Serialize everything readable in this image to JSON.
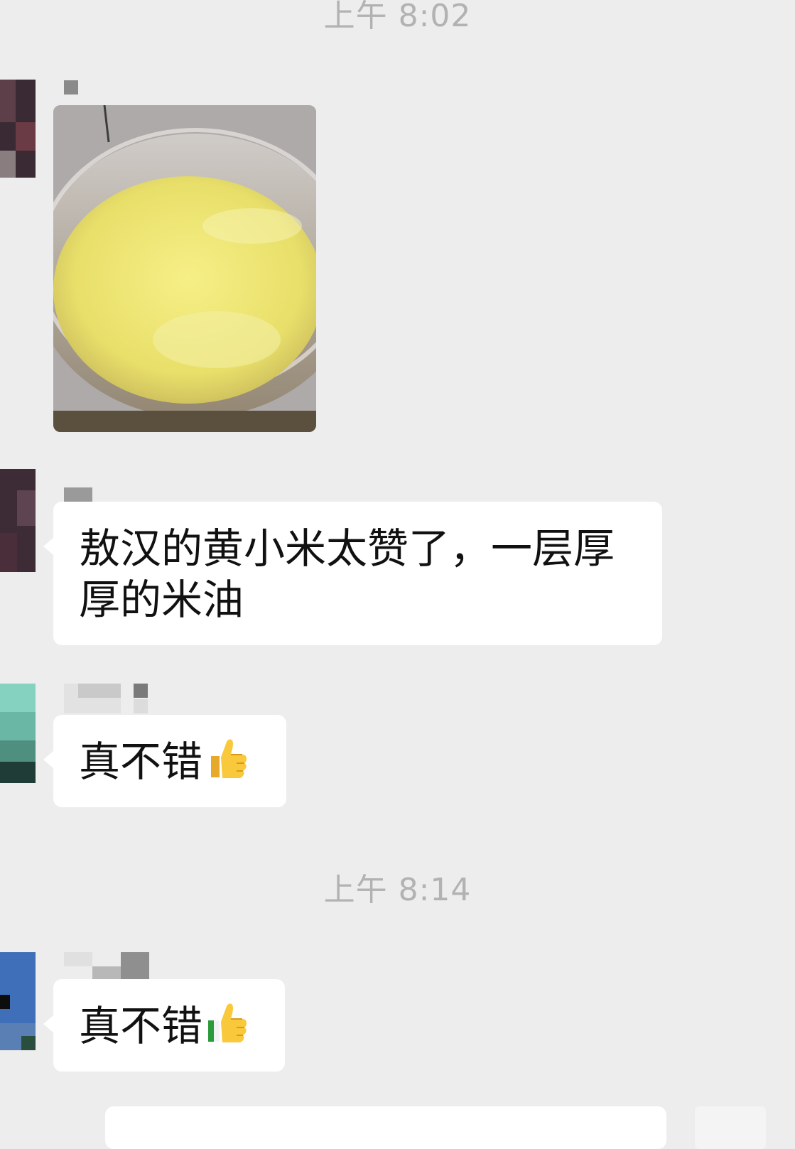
{
  "chat": {
    "timestamps": [
      "上午 8:02",
      "上午 8:14"
    ],
    "messages": [
      {
        "type": "image",
        "description_icon": "image-message"
      },
      {
        "type": "text",
        "text": "敖汉的黄小米太赞了，一层厚",
        "text_line2": "厚的米油"
      },
      {
        "type": "text",
        "text": "真不错",
        "emoji": "thumbs-up-icon"
      },
      {
        "type": "text",
        "text": "真不错",
        "emoji": "thumbs-up-icon"
      }
    ]
  },
  "colors": {
    "background": "#ededed",
    "bubble": "#ffffff",
    "timestamp": "#b2b2b2",
    "text": "#111111"
  }
}
